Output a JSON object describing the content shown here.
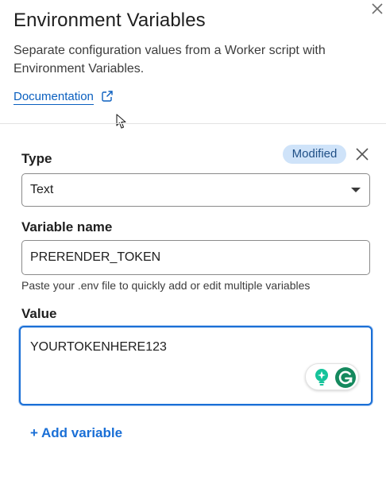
{
  "header": {
    "title": "Environment Variables",
    "subtitle": "Separate configuration values from a Worker script with Environment Variables.",
    "documentation_link": "Documentation"
  },
  "variable": {
    "badge": "Modified",
    "type_label": "Type",
    "type_value": "Text",
    "name_label": "Variable name",
    "name_value": "PRERENDER_TOKEN",
    "hint": "Paste your .env file to quickly add or edit multiple variables",
    "value_label": "Value",
    "value": "YOURTOKENHERE123"
  },
  "actions": {
    "add_variable": "+ Add variable"
  },
  "icons": {
    "close": "close-icon",
    "external_link": "external-link-icon",
    "remove": "remove-icon",
    "dropdown": "chevron-down-icon",
    "bulb": "lightbulb-icon",
    "grammarly": "grammarly-icon",
    "cursor": "mouse-cursor-icon"
  },
  "colors": {
    "link": "#0a5fbf",
    "accent": "#1a6fd6",
    "badge_bg": "#cfe3f9",
    "badge_text": "#1f4f86",
    "grammarly": "#15c39a"
  }
}
